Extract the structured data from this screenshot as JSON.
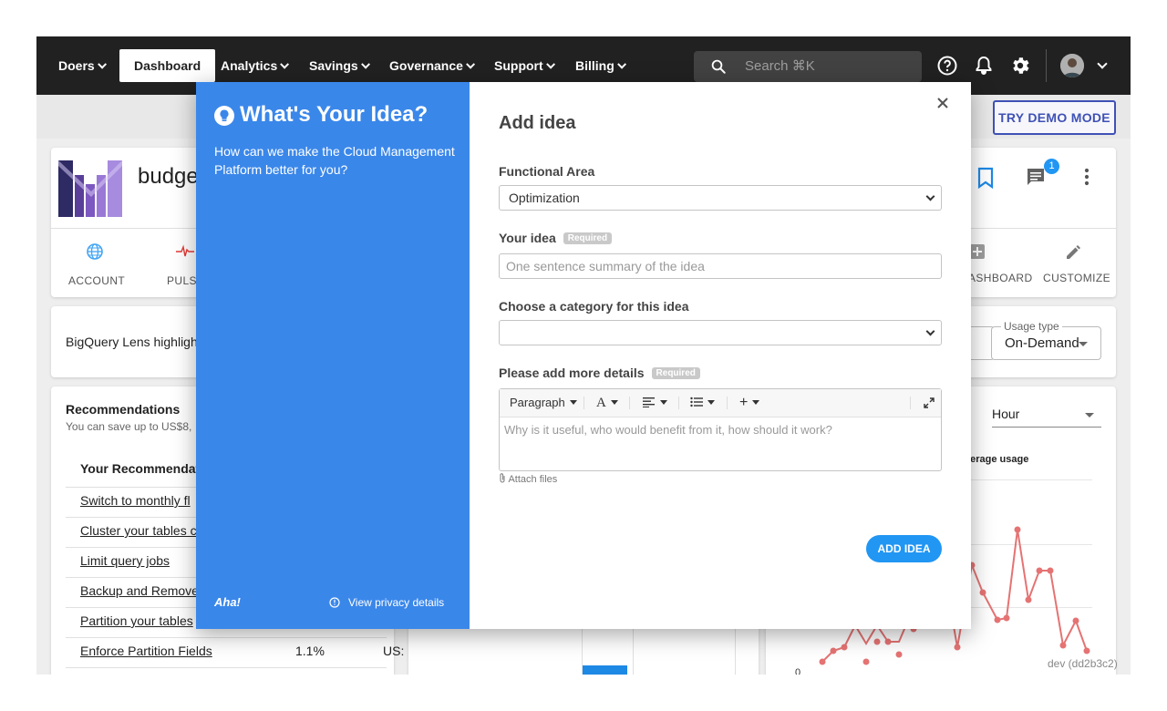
{
  "nav": {
    "org_menu": "Doers",
    "items": [
      {
        "label": "Dashboard"
      },
      {
        "label": "Analytics"
      },
      {
        "label": "Savings"
      },
      {
        "label": "Governance"
      },
      {
        "label": "Support"
      },
      {
        "label": "Billing"
      }
    ],
    "search_placeholder": "Search ⌘K"
  },
  "subbar": {
    "demo_button": "TRY DEMO MODE"
  },
  "project": {
    "title_visible": "budge",
    "tabs": [
      "ACCOUNT",
      "PULS",
      "ASHBOARD",
      "CUSTOMIZE"
    ],
    "notification_count": "1"
  },
  "banner": {
    "text": "BigQuery Lens highligh",
    "usage_type_label": "Usage type",
    "usage_type_value": "On-Demand"
  },
  "recommendations": {
    "title": "Recommendations",
    "subtitle": "You can save up to US$8,",
    "column_header": "Your Recommendat",
    "items": [
      {
        "label": "Switch to monthly fl",
        "pct": "",
        "saving": ""
      },
      {
        "label": "Cluster your tables c",
        "pct": "",
        "saving": ""
      },
      {
        "label": "Limit query jobs",
        "pct": "",
        "saving": ""
      },
      {
        "label": "Backup and Remove",
        "pct": "",
        "saving": ""
      },
      {
        "label": "Partition your tables",
        "pct": "",
        "saving": ""
      },
      {
        "label": "Enforce Partition Fields",
        "pct": "1.1%",
        "saving": "US:"
      }
    ]
  },
  "usage_chart": {
    "interval_value": "Hour",
    "series_label": "verage usage",
    "y_tick": "0"
  },
  "build_tag": "dev (dd2b3c2)",
  "modal": {
    "left_title": "What's Your Idea?",
    "left_subtitle": "How can we make the Cloud Management Platform better for you?",
    "brand": "Aha!",
    "privacy_link": "View privacy details",
    "heading": "Add idea",
    "functional_area_label": "Functional Area",
    "functional_area_value": "Optimization",
    "idea_label": "Your idea",
    "required_badge": "Required",
    "idea_placeholder": "One sentence summary of the idea",
    "category_label": "Choose a category for this idea",
    "category_value": "",
    "details_label": "Please add more details",
    "editor": {
      "paragraph": "Paragraph",
      "font_glyph": "A",
      "add_glyph": "+",
      "placeholder": "Why is it useful, who would benefit from it, how should it work?"
    },
    "attach_label": "Attach files",
    "submit": "ADD IDEA"
  },
  "colors": {
    "nav_bg": "#212121",
    "modal_left_bg": "#3a87ea",
    "accent_blue": "#2196f3",
    "demo_border": "#3f51b5",
    "chart_line": "#e57373"
  },
  "icons": [
    "search-icon",
    "help-icon",
    "bell-icon",
    "gear-icon",
    "globe-icon",
    "pulse-icon",
    "bookmark-icon",
    "comment-icon",
    "more-vert-icon",
    "pencil-icon",
    "lightbulb-icon",
    "close-icon",
    "info-icon",
    "paperclip-icon",
    "expand-icon"
  ]
}
